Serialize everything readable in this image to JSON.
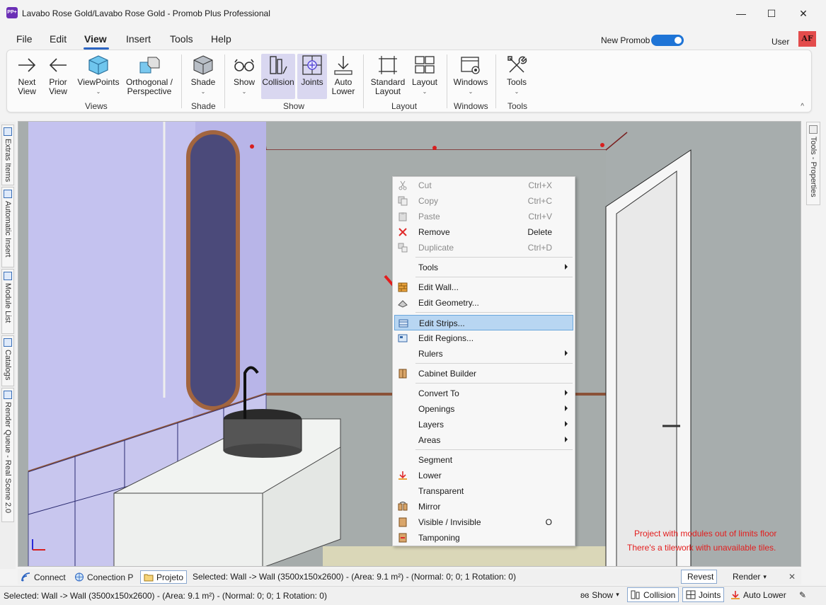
{
  "window": {
    "icon_text": "PP+",
    "title": "Lavabo Rose Gold/Lavabo Rose Gold - Promob Plus Professional",
    "minimize": "—",
    "maximize": "☐",
    "close": "✕"
  },
  "menu": {
    "items": [
      "File",
      "Edit",
      "View",
      "Insert",
      "Tools",
      "Help"
    ],
    "active": "View",
    "new_promob_label": "New Promob",
    "new_promob_on": true,
    "user_label": "User",
    "avatar": "AF"
  },
  "ribbon": {
    "buttons": {
      "next_view": "Next\nView",
      "prior_view": "Prior\nView",
      "viewpoints": "ViewPoints",
      "orthogonal": "Orthogonal /\nPerspective",
      "shade": "Shade",
      "show": "Show",
      "collision": "Collision",
      "joints": "Joints",
      "auto_lower": "Auto\nLower",
      "standard_layout": "Standard\nLayout",
      "layout": "Layout",
      "windows": "Windows",
      "tools": "Tools"
    },
    "groups": [
      "Views",
      "Shade",
      "Show",
      "Layout",
      "Windows",
      "Tools"
    ],
    "collapse": "^"
  },
  "left_tabs": [
    "Extras Items",
    "Automatic Insert",
    "Module List",
    "Catalogs",
    "Render Queue - Real Scene 2.0"
  ],
  "right_tab": "Tools - Properties",
  "viewport": {
    "warnings": [
      "Project with modules out of limits floor",
      "There's a tilework with unavailable tiles."
    ]
  },
  "context_menu": {
    "cut": "Cut",
    "cut_sc": "Ctrl+X",
    "copy": "Copy",
    "copy_sc": "Ctrl+C",
    "paste": "Paste",
    "paste_sc": "Ctrl+V",
    "remove": "Remove",
    "remove_sc": "Delete",
    "duplicate": "Duplicate",
    "duplicate_sc": "Ctrl+D",
    "tools": "Tools",
    "edit_wall": "Edit Wall...",
    "edit_geometry": "Edit Geometry...",
    "edit_strips": "Edit Strips...",
    "edit_regions": "Edit Regions...",
    "rulers": "Rulers",
    "cabinet_builder": "Cabinet Builder",
    "convert_to": "Convert To",
    "openings": "Openings",
    "layers": "Layers",
    "areas": "Areas",
    "segment": "Segment",
    "lower": "Lower",
    "transparent": "Transparent",
    "mirror": "Mirror",
    "visible_invisible": "Visible / Invisible",
    "visible_invisible_sc": "O",
    "tamponing": "Tamponing"
  },
  "bottom": {
    "connect": "Connect",
    "conection": "Conection P",
    "projeto": "Projeto",
    "selection_inline": "Selected: Wall -> Wall (3500x150x2600) - (Area: 9.1 m²) - (Normal: 0; 0; 1 Rotation: 0)",
    "revest": "Revest",
    "render": "Render",
    "close": "✕"
  },
  "status": {
    "text": "Selected: Wall -> Wall (3500x150x2600) - (Area: 9.1 m²) - (Normal: 0; 0; 1 Rotation: 0)",
    "show": "Show",
    "collision": "Collision",
    "joints": "Joints",
    "auto_lower": "Auto Lower"
  },
  "colors": {
    "accent": "#1e74d6",
    "menu_highlight": "#b8d6f2",
    "warning": "#e31e1e",
    "pressed_button": "#d9d7f0"
  }
}
